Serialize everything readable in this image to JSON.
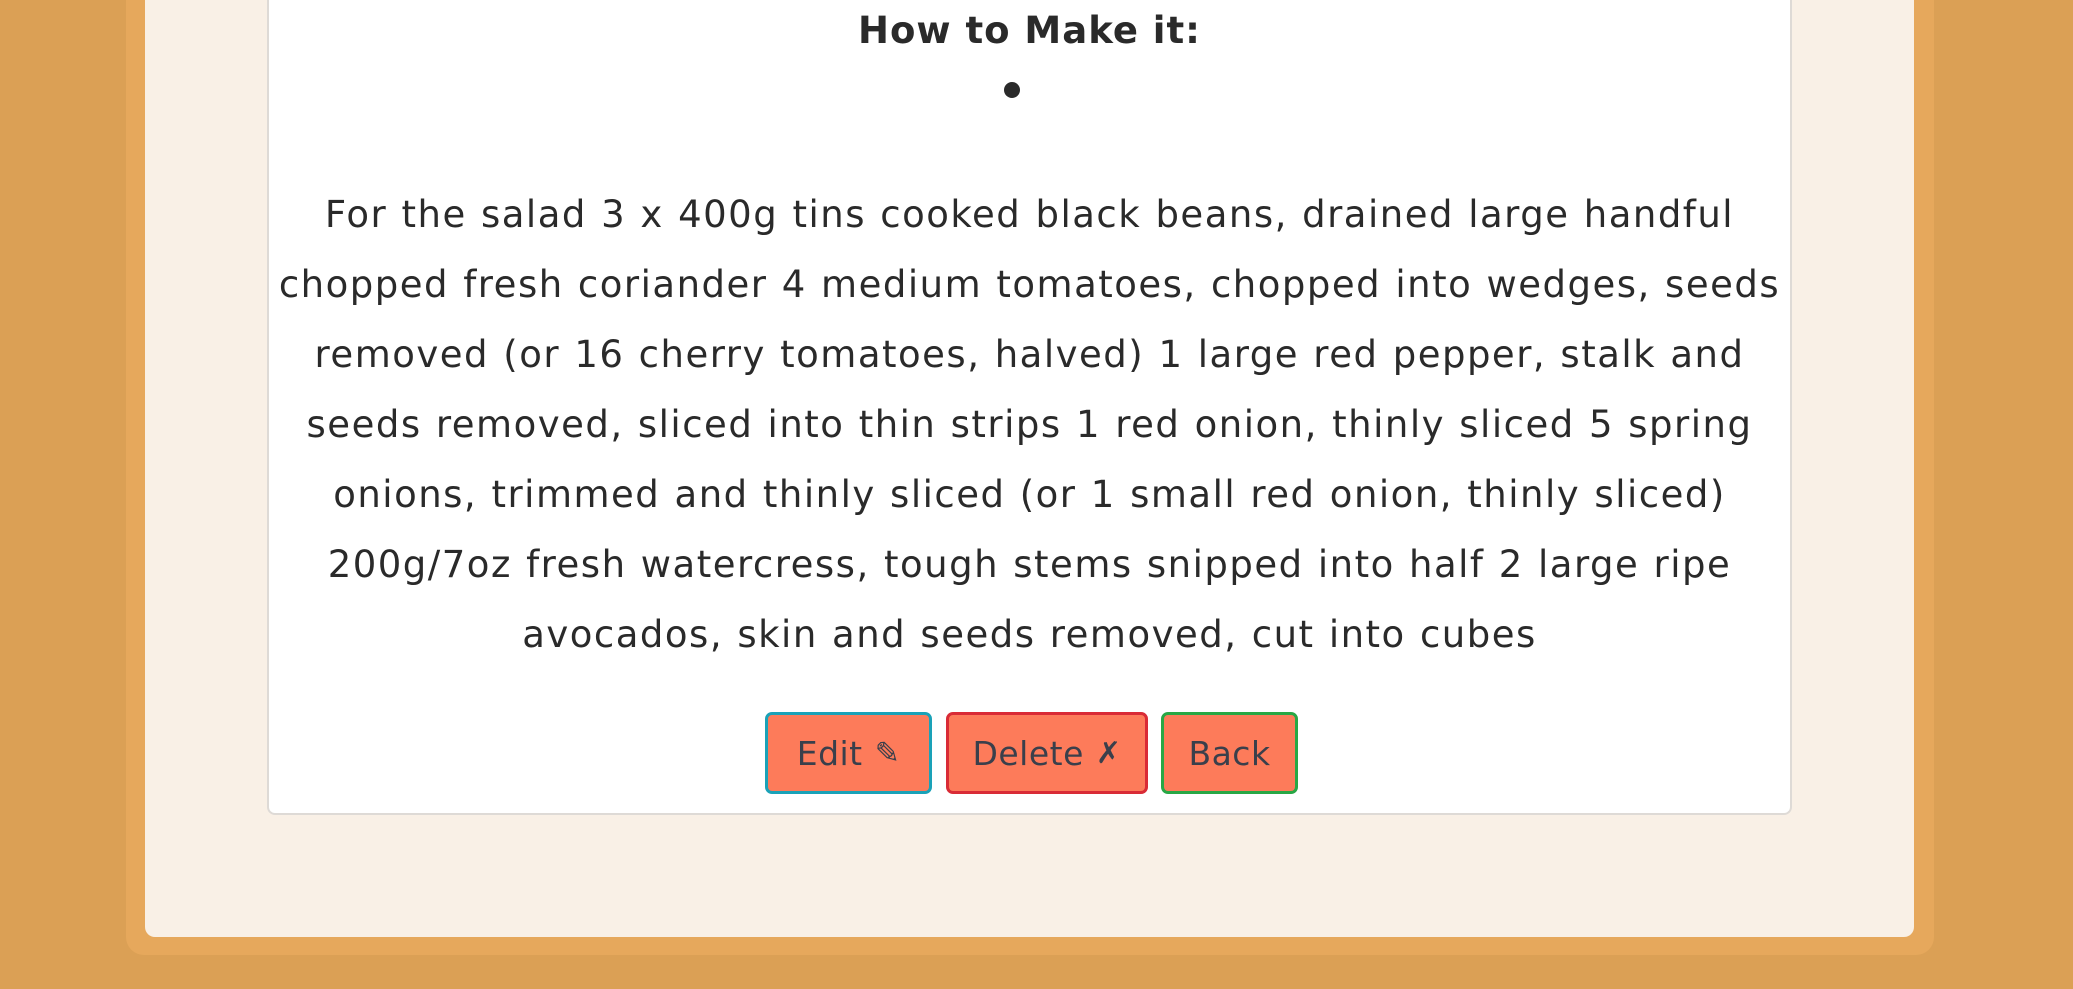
{
  "recipe": {
    "method_heading": "How to Make it:",
    "instructions": "For the salad 3 x 400g tins cooked black beans, drained large handful chopped fresh coriander 4 medium tomatoes, chopped into wedges, seeds removed (or 16 cherry tomatoes, halved) 1 large red pepper, stalk and seeds removed, sliced into thin strips 1 red onion, thinly sliced 5 spring onions, trimmed and thinly sliced (or 1 small red onion, thinly sliced) 200g/7oz fresh watercress, tough stems snipped into half 2 large ripe avocados, skin and seeds removed, cut into cubes"
  },
  "actions": {
    "edit_label": "Edit",
    "edit_icon": "✎",
    "delete_label": "Delete",
    "delete_icon": "✗",
    "back_label": "Back"
  },
  "colors": {
    "page_background": "#dba055",
    "panel_background": "#f9f0e6",
    "button_fill": "#fd7b5a",
    "edit_border": "#1aa2b8",
    "delete_border": "#d92b36",
    "back_border": "#28a745"
  },
  "icons": {
    "edit": "pencil-icon",
    "delete": "cross-icon"
  }
}
